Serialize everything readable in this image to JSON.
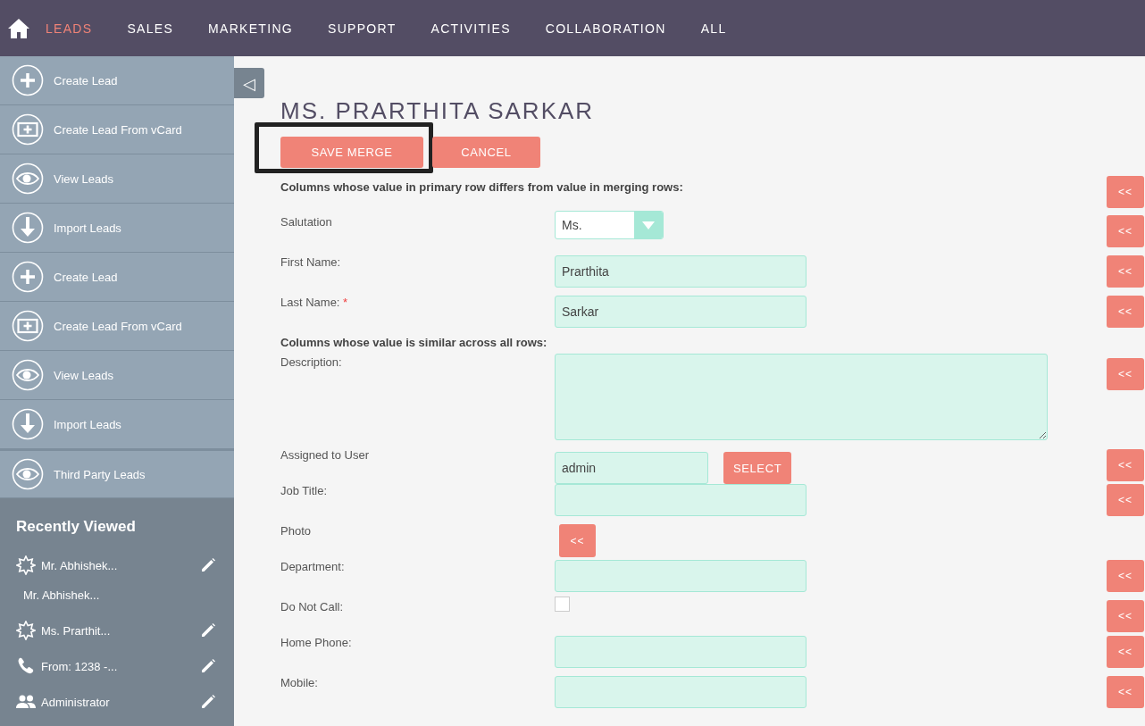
{
  "nav": {
    "items": [
      {
        "label": "LEADS",
        "selected": true
      },
      {
        "label": "SALES",
        "selected": false
      },
      {
        "label": "MARKETING",
        "selected": false
      },
      {
        "label": "SUPPORT",
        "selected": false
      },
      {
        "label": "ACTIVITIES",
        "selected": false
      },
      {
        "label": "COLLABORATION",
        "selected": false
      },
      {
        "label": "ALL",
        "selected": false
      }
    ]
  },
  "sidebar": {
    "actions": [
      {
        "label": "Create Lead",
        "kind": "plus"
      },
      {
        "label": "Create Lead From vCard",
        "kind": "card"
      },
      {
        "label": "View Leads",
        "kind": "eye"
      },
      {
        "label": "Import Leads",
        "kind": "import"
      },
      {
        "label": "Create Lead",
        "kind": "plus"
      },
      {
        "label": "Create Lead From vCard",
        "kind": "card"
      },
      {
        "label": "View Leads",
        "kind": "eye"
      },
      {
        "label": "Import Leads",
        "kind": "import"
      },
      {
        "label": "Third Party Leads",
        "kind": "eye"
      }
    ],
    "recent_title": "Recently Viewed",
    "recent": [
      {
        "label": "Mr. Abhishek...",
        "kind": "lead",
        "editable": true
      },
      {
        "label": "Mr. Abhishek...",
        "kind": "none",
        "editable": false
      },
      {
        "label": "Ms. Prarthit...",
        "kind": "lead",
        "editable": true
      },
      {
        "label": "From: 1238 -...",
        "kind": "call",
        "editable": true
      },
      {
        "label": "Administrator",
        "kind": "user",
        "editable": true
      }
    ]
  },
  "collapse": "◁",
  "title": "MS. PRARTHITA SARKAR",
  "buttons": [
    {
      "label": "SAVE MERGE",
      "highlighted": true
    },
    {
      "label": "CANCEL",
      "highlighted": false
    }
  ],
  "rows": [
    {
      "kind": "section",
      "label": "Columns whose value in primary row differs from value in merging rows:",
      "merge": "<<"
    },
    {
      "kind": "select",
      "label": "Salutation",
      "value": "Ms.",
      "merge": "<<"
    },
    {
      "kind": "text",
      "label": "First Name:",
      "value": "Prarthita",
      "merge": "<<"
    },
    {
      "kind": "text",
      "label": "Last Name:",
      "required_mark": "*",
      "value": "Sarkar",
      "merge": "<<"
    },
    {
      "kind": "section",
      "label": "Columns whose value is similar across all rows:"
    },
    {
      "kind": "textarea",
      "label": "Description:",
      "merge": "<<"
    },
    {
      "kind": "lookup",
      "label": "Assigned to User",
      "value": "admin",
      "action": "SELECT",
      "merge": "<<"
    },
    {
      "kind": "text",
      "label": "Job Title:",
      "merge": "<<"
    },
    {
      "kind": "photo",
      "label": "Photo",
      "action": "<<"
    },
    {
      "kind": "text",
      "label": "Department:",
      "merge": "<<"
    },
    {
      "kind": "checkbox",
      "label": "Do Not Call:",
      "checked": false,
      "merge": "<<"
    },
    {
      "kind": "text",
      "label": "Home Phone:",
      "merge": "<<"
    },
    {
      "kind": "text",
      "label": "Mobile:",
      "merge": "<<"
    }
  ]
}
